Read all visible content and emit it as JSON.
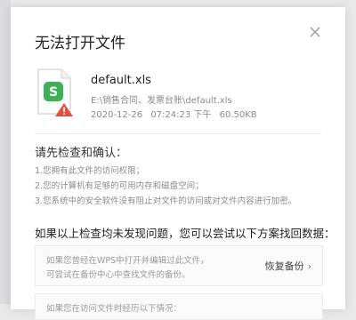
{
  "dialog": {
    "title": "无法打开文件"
  },
  "file": {
    "name": "default.xls",
    "path": "E:\\销售合同、发票台账\\default.xls",
    "date": "2020-12-26",
    "time": "07:24:23 下午",
    "size": "60.50KB"
  },
  "check": {
    "title": "请先检查和确认：",
    "items": [
      "1.您拥有此文件的访问权限；",
      "2.您的计算机有足够的可用内存和磁盘空间；",
      "3.您系统中的安全软件没有阻止对文件的访问或对文件内容进行加密。"
    ]
  },
  "recover": {
    "title": "如果以上检查均未发现问题，您可以尝试以下方案找回数据：",
    "card1": {
      "line1": "如果您曾经在WPS中打开并编辑过此文件，",
      "line2": "可尝试在备份中心中查找文件的备份。",
      "button": "恢复备份"
    },
    "card2": {
      "line1": "如果您在访问文件时经历以下情况："
    }
  },
  "colors": {
    "icon_green": "#3fb05a",
    "warning_red": "#e74c3c"
  }
}
